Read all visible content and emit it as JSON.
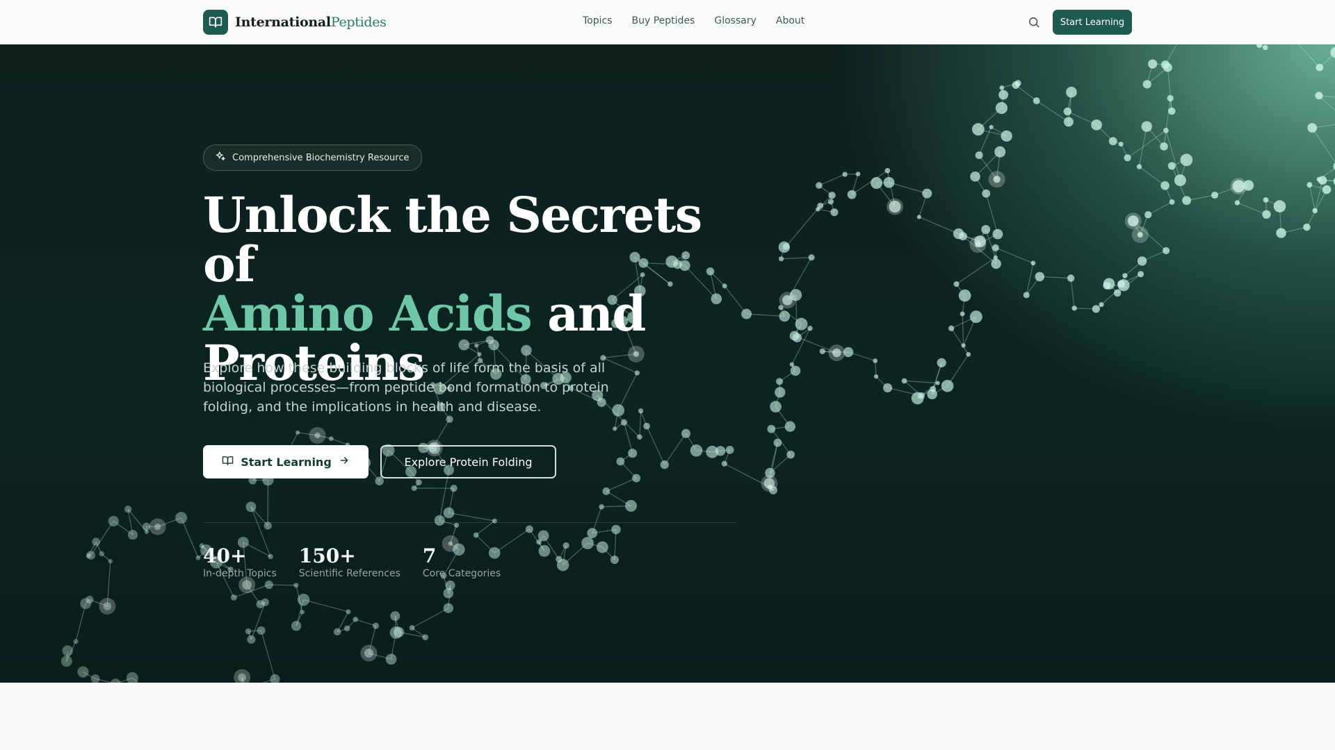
{
  "header": {
    "logo_text_main": "International",
    "logo_text_accent": "Peptides",
    "logo_icon": "book-open-icon",
    "nav": [
      {
        "label": "Topics"
      },
      {
        "label": "Buy Peptides"
      },
      {
        "label": "Glossary"
      },
      {
        "label": "About"
      }
    ],
    "search_icon": "search-icon",
    "cta_label": "Start Learning"
  },
  "hero": {
    "badge_icon": "sparkles-icon",
    "badge_label": "Comprehensive Biochemistry Resource",
    "headline_part1": "Unlock the Secrets of",
    "headline_highlight": "Amino Acids",
    "headline_part2": " and",
    "headline_part3": "Proteins",
    "subtext": "Explore how these building blocks of life form the basis of all biological processes—from peptide bond formation to protein folding, and the implications in health and disease.",
    "primary_button": {
      "label": "Start Learning",
      "icon": "book-open-icon",
      "trailing_icon": "arrow-right-icon"
    },
    "secondary_button": {
      "label": "Explore Protein Folding"
    },
    "stats": [
      {
        "value": "40+",
        "label": "In-depth Topics"
      },
      {
        "value": "150+",
        "label": "Scientific References"
      },
      {
        "value": "7",
        "label": "Core Categories"
      }
    ],
    "colors": {
      "accent": "#6fc7a7",
      "brand": "#1e5a4e"
    }
  }
}
